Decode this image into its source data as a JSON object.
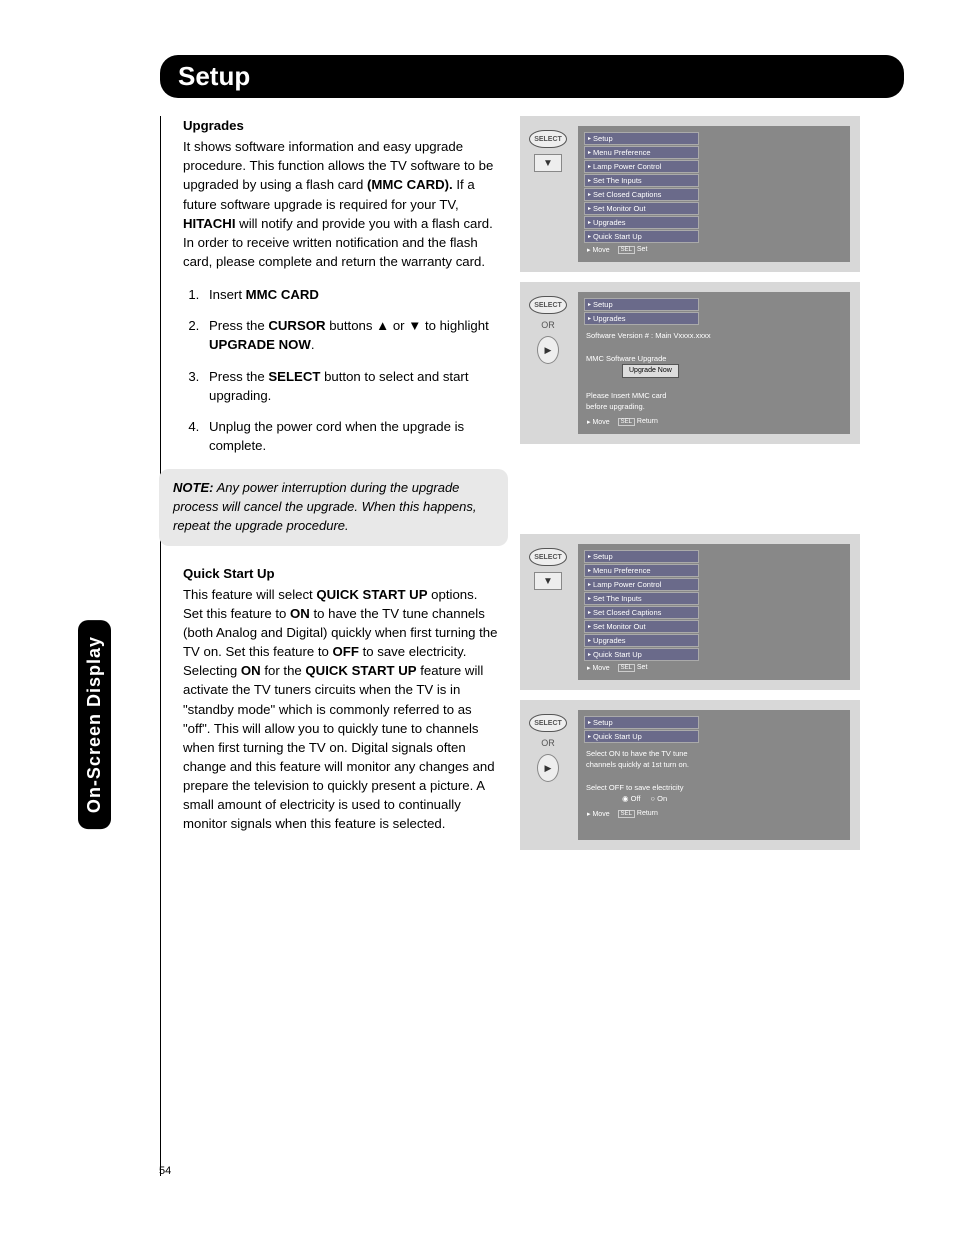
{
  "header": {
    "title": "Setup"
  },
  "side_tab": "On-Screen Display",
  "page_number": "54",
  "upgrades": {
    "heading": "Upgrades",
    "intro_a": "It shows software information and easy upgrade procedure. This function allows the TV software to be upgraded by using a flash card ",
    "mmc_card": "(MMC CARD).",
    "intro_b": " If a future software upgrade is required for your TV, ",
    "hitachi": "HITACHI",
    "intro_c": " will notify and provide you with a flash card. In order to receive written notification and the flash card, please complete and return the warranty card.",
    "step1_a": "Insert ",
    "step1_b": "MMC CARD",
    "step2_a": "Press the ",
    "step2_b": "CURSOR",
    "step2_c": " buttons ▲ or ▼ to highlight ",
    "step2_d": "UPGRADE NOW",
    "step2_e": ".",
    "step3_a": "Press the ",
    "step3_b": "SELECT",
    "step3_c": " button to select and start upgrading.",
    "step4": "Unplug the power cord when the upgrade is complete."
  },
  "note": {
    "label": "NOTE:",
    "text": "Any power interruption during the upgrade process will cancel the upgrade. When this happens, repeat the upgrade procedure."
  },
  "quickstart": {
    "heading": "Quick Start Up",
    "p1": "This feature will select ",
    "p2": "QUICK START UP",
    "p3": " options. Set this feature to ",
    "p4": "ON",
    "p5": " to have the TV tune channels (both Analog and Digital) quickly when first turning the TV on. Set this feature to ",
    "p6": "OFF",
    "p7": " to save electricity. Selecting ",
    "p8": "ON",
    "p9": " for the ",
    "p10": "QUICK START UP",
    "p11": " feature will activate the TV tuners circuits when the TV is in \"standby mode\" which is commonly referred to as \"off\". This will allow you to quickly tune to channels when first turning the TV on. Digital signals often change and this feature will monitor any changes and prepare the television to quickly present a picture. A small amount of electricity is used to continually monitor signals when this feature is selected."
  },
  "osd": {
    "select_label": "SELECT",
    "or_label": "OR",
    "menu_items": [
      "Setup",
      "Menu Preference",
      "Lamp Power Control",
      "Set The Inputs",
      "Set Closed Captions",
      "Set Monitor Out",
      "Upgrades",
      "Quick Start Up"
    ],
    "foot_move": "Move",
    "foot_sel": "SEL",
    "foot_set": "Set",
    "foot_return": "Return",
    "panel2": {
      "crumb": [
        "Setup",
        "Upgrades"
      ],
      "version": "Software Version #  :  Main Vxxxx.xxxx",
      "mmc": "MMC Software Upgrade",
      "btn": "Upgrade Now",
      "warn1": "Please Insert MMC card",
      "warn2": "before upgrading."
    },
    "panel4": {
      "crumb": [
        "Setup",
        "Quick Start Up"
      ],
      "line1": "Select ON to have the TV tune",
      "line2": "channels quickly at 1st turn on.",
      "line3": "Select OFF to save electricity",
      "off": "Off",
      "on": "On"
    }
  }
}
